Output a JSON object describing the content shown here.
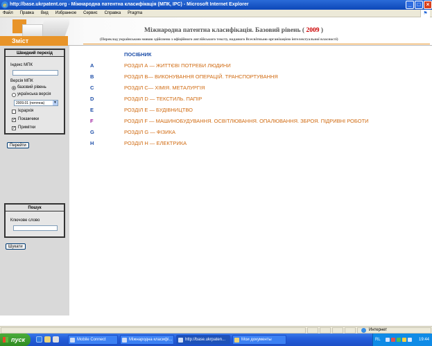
{
  "window": {
    "title": "http://base.ukrpatent.org - Міжнародна патентна класифікація (МПК, IPC) - Microsoft Internet Explorer",
    "ie_glyph": "e"
  },
  "menu": [
    "Файл",
    "Правка",
    "Вид",
    "Избранное",
    "Сервис",
    "Справка",
    "Pragma"
  ],
  "header": {
    "logo_label": "Зміст",
    "title": "Міжнародна патентна класифікація. Базовий рівень (",
    "year": "2009",
    "title_end": ")",
    "subtitle": "(Переклад українською мовою здійснено з офіційного англійського тексту, наданого Всесвітньою організацією інтелектуальної власності)"
  },
  "quick_nav": {
    "heading": "Швидкий перехід",
    "index_label": "Індекс МПК",
    "index_value": "",
    "version_label": "Версія МПК",
    "radio_basic": "базовий рівень",
    "radio_ukr": "українська версія",
    "version_select": "2009.01 (поточна)",
    "chk_hierarchy": "Ієрархія",
    "chk_pointers": "Покажчики",
    "chk_notes": "Примітки",
    "go_button": "Перейти"
  },
  "search": {
    "heading": "Пошук",
    "keyword_label": "Ключове слово",
    "keyword_value": "",
    "search_button": "Шукати"
  },
  "content": {
    "guide": "ПОСІБНИК",
    "sections": [
      {
        "letter": "A",
        "text": "РОЗДІЛ А — ЖИТТЄВІ ПОТРЕБИ ЛЮДИНИ",
        "letter_color": "#1d4ea8"
      },
      {
        "letter": "B",
        "text": "РОЗДІЛ В— ВИКОНУВАННЯ ОПЕРАЦІЙ. ТРАНСПОРТУВАННЯ",
        "letter_color": "#1d4ea8"
      },
      {
        "letter": "C",
        "text": "РОЗДІЛ С— ХІМІЯ. МЕТАЛУРГІЯ",
        "letter_color": "#1d4ea8"
      },
      {
        "letter": "D",
        "text": "РОЗДІЛ D — ТЕКСТИЛЬ. ПАПІР",
        "letter_color": "#1d4ea8"
      },
      {
        "letter": "E",
        "text": "РОЗДІЛ Е — БУДІВНИЦТВО",
        "letter_color": "#1d4ea8"
      },
      {
        "letter": "F",
        "text": "РОЗДІЛ F — МАШИНОБУДУВАННЯ. ОСВІТЛЮВАННЯ. ОПАЛЮВАННЯ. ЗБРОЯ. ПІДРИВНІ РОБОТИ",
        "letter_color": "#a020a0"
      },
      {
        "letter": "G",
        "text": "РОЗДІЛ G — ФІЗИКА",
        "letter_color": "#1d4ea8"
      },
      {
        "letter": "H",
        "text": "РОЗДІЛ Н — ЕЛЕКТРИКА",
        "letter_color": "#1d4ea8"
      }
    ]
  },
  "status": {
    "zone": "Интернет"
  },
  "taskbar": {
    "start": "пуск",
    "tasks": [
      "Mobile Connect",
      "Міжнародна класифі...",
      "http://base.ukrpaten...",
      "Мои документы"
    ],
    "lang": "RL",
    "clock": "19:44"
  }
}
